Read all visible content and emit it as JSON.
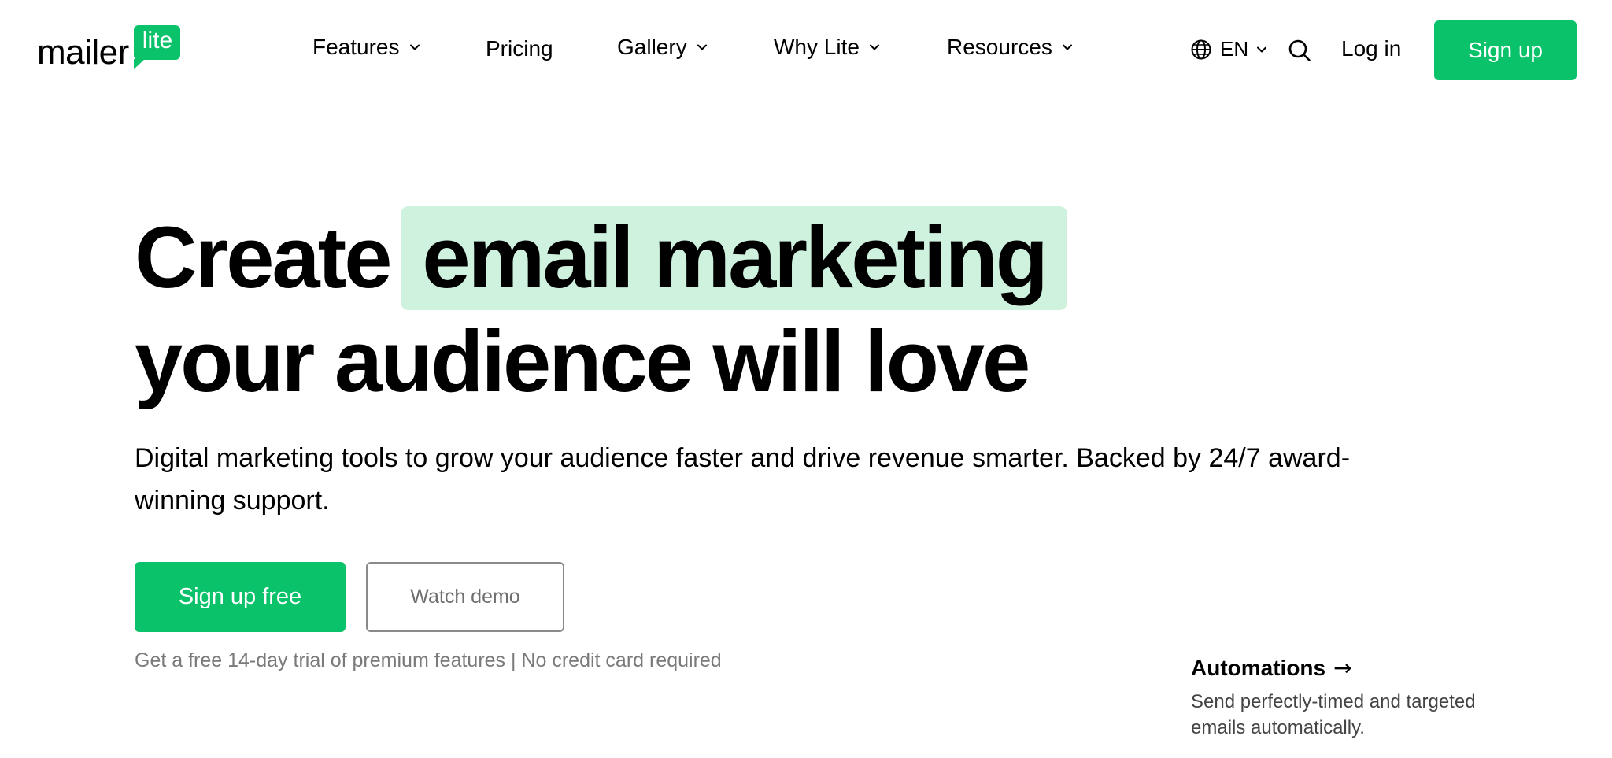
{
  "brand": {
    "logo_word": "mailer",
    "logo_badge": "lite",
    "accent_color": "#09c269",
    "highlight_color": "#cff2df"
  },
  "nav": {
    "items": [
      {
        "label": "Features",
        "has_dropdown": true
      },
      {
        "label": "Pricing",
        "has_dropdown": false
      },
      {
        "label": "Gallery",
        "has_dropdown": true
      },
      {
        "label": "Why Lite",
        "has_dropdown": true
      },
      {
        "label": "Resources",
        "has_dropdown": true
      }
    ],
    "language": "EN",
    "login_label": "Log in",
    "signup_label": "Sign up"
  },
  "hero": {
    "headline_prefix": "Create",
    "headline_highlight": "email marketing",
    "headline_line2": "your audience will love",
    "subtitle": "Digital marketing tools to grow your audience faster and drive revenue smarter. Backed by 24/7 award-winning support.",
    "primary_cta": "Sign up free",
    "secondary_cta": "Watch demo",
    "trial_note": "Get a free 14-day trial of premium features | No credit card required"
  },
  "feature_card": {
    "title": "Automations",
    "arrow": "→",
    "description": "Send perfectly-timed and targeted emails automatically."
  }
}
